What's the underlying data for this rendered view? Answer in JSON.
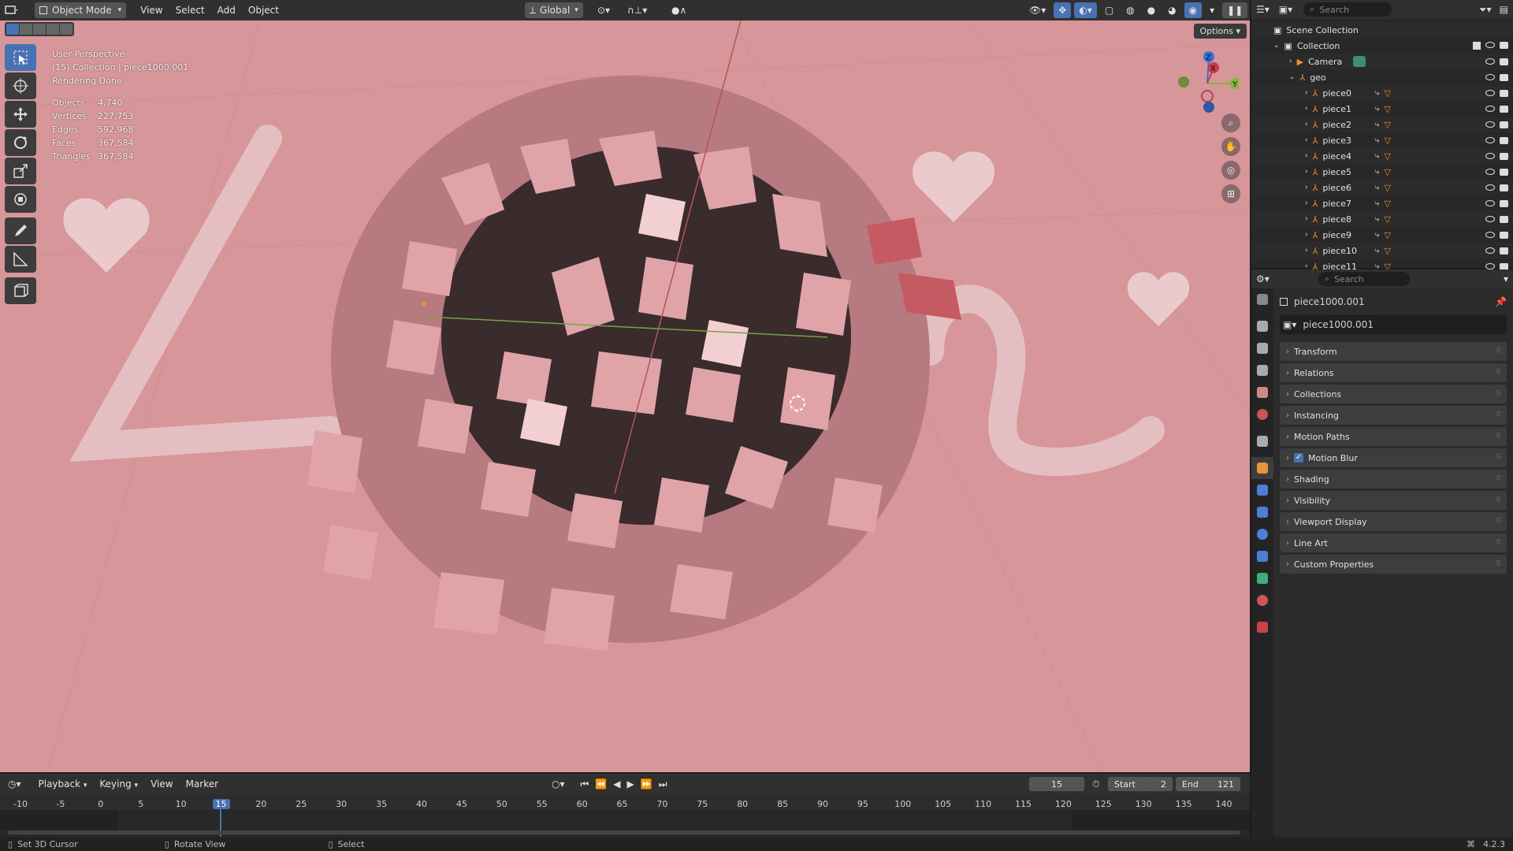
{
  "header": {
    "mode": "Object Mode",
    "menus": [
      "View",
      "Select",
      "Add",
      "Object"
    ],
    "orientation": "Global",
    "options_label": "Options"
  },
  "viewport": {
    "perspective": "User Perspective",
    "collection_info": "(15) Collection | piece1000.001",
    "render_status": "Rendering Done",
    "stats": [
      {
        "label": "Objects",
        "value": "4,740"
      },
      {
        "label": "Vertices",
        "value": "227,753"
      },
      {
        "label": "Edges",
        "value": "592,968"
      },
      {
        "label": "Faces",
        "value": "367,584"
      },
      {
        "label": "Triangles",
        "value": "367,584"
      }
    ],
    "gizmo_axes": [
      "Z",
      "X",
      "Y"
    ]
  },
  "toolbar": {
    "tools": [
      "select-box",
      "cursor",
      "move",
      "rotate",
      "scale",
      "transform",
      "annotate",
      "measure",
      "add-cube"
    ]
  },
  "outliner": {
    "search_placeholder": "Search",
    "scene_collection": "Scene Collection",
    "collection": "Collection",
    "camera": "Camera",
    "geo": "geo",
    "pieces": [
      "piece0",
      "piece1",
      "piece2",
      "piece3",
      "piece4",
      "piece5",
      "piece6",
      "piece7",
      "piece8",
      "piece9",
      "piece10",
      "piece11"
    ]
  },
  "properties": {
    "search_placeholder": "Search",
    "object_name": "piece1000.001",
    "data_name": "piece1000.001",
    "panels": [
      "Transform",
      "Relations",
      "Collections",
      "Instancing",
      "Motion Paths",
      "Motion Blur",
      "Shading",
      "Visibility",
      "Viewport Display",
      "Line Art",
      "Custom Properties"
    ],
    "motion_blur_checked": true
  },
  "timeline": {
    "menus": [
      "Playback",
      "Keying",
      "View",
      "Marker"
    ],
    "current_frame": "15",
    "start_label": "Start",
    "start_value": "2",
    "end_label": "End",
    "end_value": "121",
    "ticks": [
      "-10",
      "-5",
      "0",
      "5",
      "10",
      "15",
      "20",
      "25",
      "30",
      "35",
      "40",
      "45",
      "50",
      "55",
      "60",
      "65",
      "70",
      "75",
      "80",
      "85",
      "90",
      "95",
      "100",
      "105",
      "110",
      "115",
      "120",
      "125",
      "130",
      "135",
      "140"
    ]
  },
  "statusbar": {
    "left": "Set 3D Cursor",
    "middle": "Rotate View",
    "right": "Select",
    "version": "4.2.3"
  },
  "colors": {
    "accent": "#4772b3",
    "viewport_bg": "#d6969a",
    "object_orange": "#e8923a"
  }
}
